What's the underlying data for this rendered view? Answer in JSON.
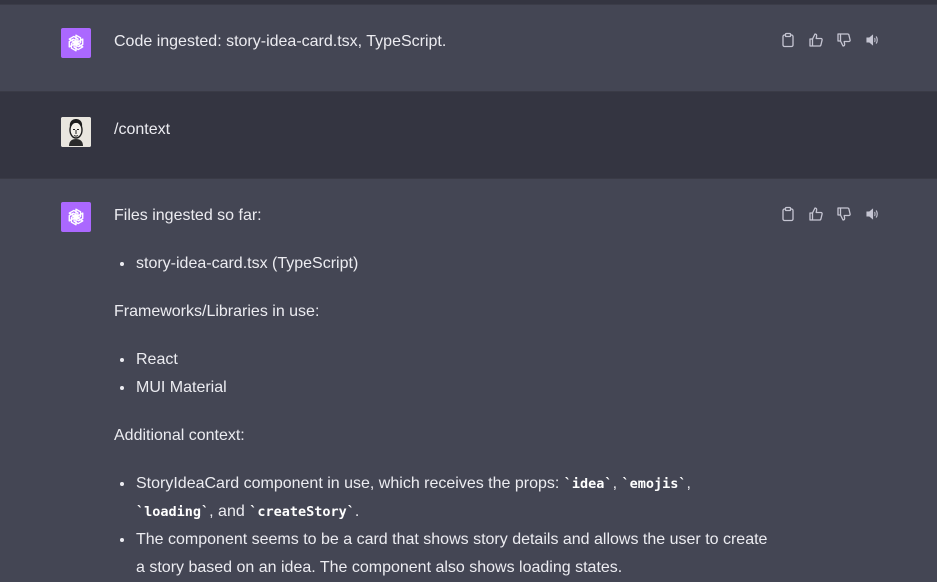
{
  "messages": [
    {
      "role": "assistant",
      "text": "Code ingested: story-idea-card.tsx, TypeScript."
    },
    {
      "role": "user",
      "text": "/context"
    },
    {
      "role": "assistant",
      "heading_files": "Files ingested so far:",
      "files": [
        "story-idea-card.tsx (TypeScript)"
      ],
      "heading_frameworks": "Frameworks/Libraries in use:",
      "frameworks": [
        "React",
        "MUI Material"
      ],
      "heading_context": "Additional context:",
      "context_item_1": {
        "prefix": "StoryIdeaCard component in use, which receives the props: ",
        "code_1": "`idea`",
        "sep_1": ", ",
        "code_2": "`emojis`",
        "sep_2": ", ",
        "code_3": "`loading`",
        "sep_3": ", and ",
        "code_4": "`createStory`",
        "suffix": "."
      },
      "context_item_2": "The component seems to be a card that shows story details and allows the user to create a story based on an idea. The component also shows loading states."
    }
  ],
  "icons": {
    "copy": "clipboard-icon",
    "like": "thumbs-up-icon",
    "dislike": "thumbs-down-icon",
    "speak": "speaker-icon"
  },
  "colors": {
    "assistant_bg": "#444654",
    "user_bg": "#343541",
    "gpt_avatar": "#ab68ff"
  }
}
